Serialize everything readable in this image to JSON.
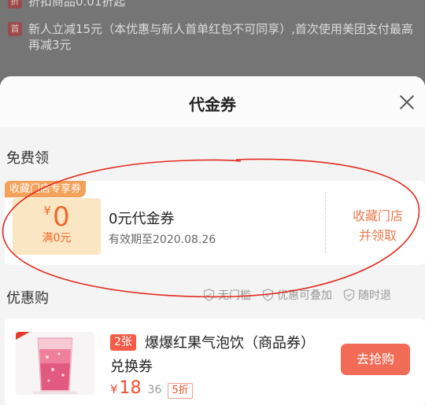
{
  "background": {
    "row1_tag": "折",
    "row1_text": "折扣商品0.01折起",
    "row2_tag": "首",
    "row2_text": "新人立减15元（本优惠与新人首单红包不可同享）,首次使用美团支付最高再减3元"
  },
  "sheet": {
    "title": "代金券",
    "close_icon": "close-icon"
  },
  "free_section": {
    "title": "免费领",
    "coupon": {
      "store_tag": "收藏门店专享券",
      "currency": "¥",
      "amount": "0",
      "condition": "满0元",
      "name": "0元代金券",
      "expiry": "有效期至2020.08.26",
      "collect_line1": "收藏门店",
      "collect_line2": "并领取"
    }
  },
  "buy_section": {
    "title": "优惠购",
    "badges": [
      "无门槛",
      "优惠可叠加",
      "随时退"
    ],
    "product": {
      "count_tag": "2张",
      "name": "爆爆红果气泡饮（商品券）兑换券",
      "currency": "¥",
      "price": "18",
      "original_price": "36",
      "discount": "5折",
      "button": "去抢购"
    }
  },
  "colors": {
    "accent": "#ef6a2b",
    "button": "#f26b57",
    "annotation_ellipse": "#e32b20"
  }
}
